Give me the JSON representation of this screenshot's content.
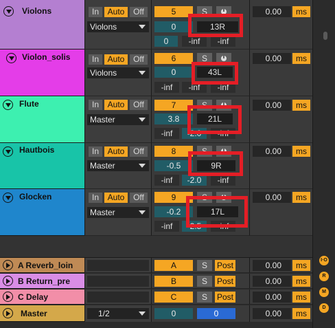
{
  "tracks": [
    {
      "name": "Violons",
      "color": "#b47fd1",
      "input": "Violons",
      "show_input_dropdown": true,
      "track_number": "5",
      "volume": "0",
      "pan": "13R",
      "send_a": "0",
      "meter_left": "-inf",
      "meter_right": "-inf",
      "delay": "0.00",
      "delay_unit": "ms",
      "auto_on": true
    },
    {
      "name": "Violon_solis",
      "color": "#e43de8",
      "input": "Violons",
      "track_number": "6",
      "volume": "0",
      "pan": "43L",
      "send_a": "-inf",
      "meter_left": "-inf",
      "meter_right": "-inf",
      "delay": "0.00",
      "delay_unit": "ms",
      "auto_on": true
    },
    {
      "name": "Flute",
      "color": "#3df0b0",
      "input": "Master",
      "track_number": "7",
      "volume": "3.8",
      "pan": "21L",
      "send_a": "-inf",
      "meter_left": "-2.0",
      "meter_right": "-inf",
      "delay": "0.00",
      "delay_unit": "ms",
      "auto_on": true
    },
    {
      "name": "Hautbois",
      "color": "#18c4a8",
      "input": "Master",
      "track_number": "8",
      "volume": "-0.5",
      "pan": "9R",
      "send_a": "-inf",
      "meter_left": "-2.0",
      "meter_right": "-inf",
      "delay": "0.00",
      "delay_unit": "ms",
      "auto_on": true
    },
    {
      "name": "Glocken",
      "color": "#1f86cc",
      "input": "Master",
      "track_number": "9",
      "volume": "-0.2",
      "pan": "17L",
      "send_a": "-inf",
      "meter_left": "-2.5",
      "meter_right": "-inf",
      "delay": "0.00",
      "delay_unit": "ms",
      "auto_on": true
    }
  ],
  "buttons": {
    "in": "In",
    "auto": "Auto",
    "off": "Off",
    "solo": "S",
    "post": "Post"
  },
  "returns": [
    {
      "name": "A Reverb_loin",
      "color": "#bf8a55",
      "letter": "A",
      "delay": "0.00",
      "unit": "ms"
    },
    {
      "name": "B Return_pre",
      "color": "#d98de6",
      "letter": "B",
      "delay": "0.00",
      "unit": "ms"
    },
    {
      "name": "C Delay",
      "color": "#f28ea8",
      "letter": "C",
      "delay": "0.00",
      "unit": "ms"
    }
  ],
  "master": {
    "name": "Master",
    "color": "#d4a84a",
    "cue": "1/2",
    "volume": "0",
    "pan": "0",
    "delay": "0.00",
    "unit": "ms"
  },
  "side_icons": [
    "I·O",
    "R",
    "M",
    "D"
  ],
  "colors": {
    "accent": "#f5a623",
    "highlight": "#e41e26"
  }
}
